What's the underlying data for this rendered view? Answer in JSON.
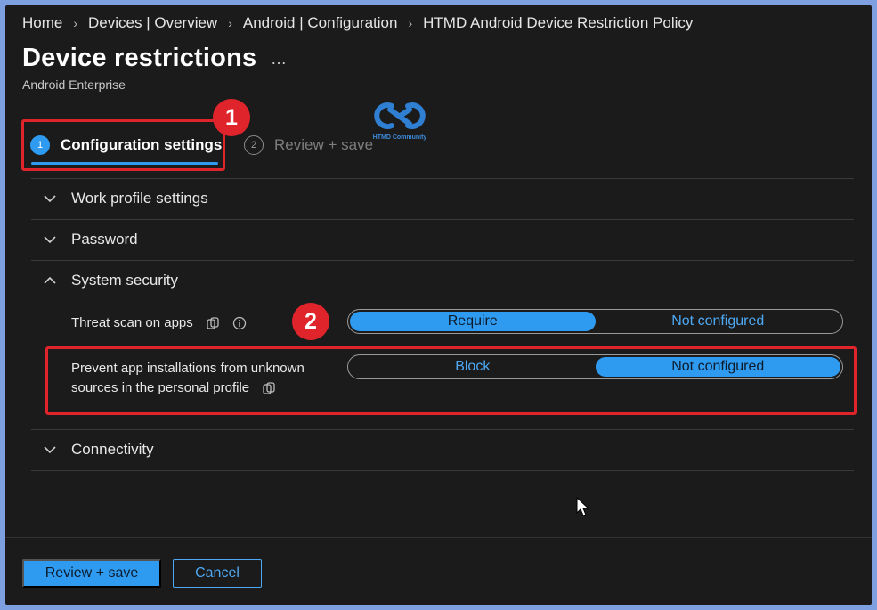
{
  "breadcrumb": [
    "Home",
    "Devices | Overview",
    "Android | Configuration",
    "HTMD Android Device Restriction Policy"
  ],
  "header": {
    "title": "Device restrictions",
    "more": "…",
    "subtitle": "Android Enterprise"
  },
  "logo": {
    "text": "HTMD Community"
  },
  "wizard": {
    "steps": [
      {
        "number": "1",
        "label": "Configuration settings",
        "active": true
      },
      {
        "number": "2",
        "label": "Review + save",
        "active": false
      }
    ]
  },
  "annotations": {
    "badge1": "1",
    "badge2": "2"
  },
  "sections": {
    "work_profile": "Work profile settings",
    "password": "Password",
    "system_security": "System security",
    "connectivity": "Connectivity"
  },
  "settings": {
    "threat_scan": {
      "label": "Threat scan on apps",
      "options": [
        "Require",
        "Not configured"
      ],
      "selected": "Require"
    },
    "prevent_unknown": {
      "label_line1": "Prevent app installations from unknown",
      "label_line2": "sources in the personal profile",
      "options": [
        "Block",
        "Not configured"
      ],
      "selected": "Not configured"
    }
  },
  "footer": {
    "review_save": "Review + save",
    "cancel": "Cancel"
  },
  "colors": {
    "accent": "#2e9bf0",
    "highlight": "#e0242b",
    "background": "#1b1b1b"
  }
}
